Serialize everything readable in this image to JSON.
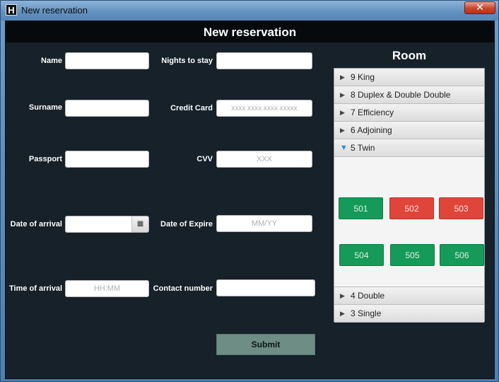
{
  "window": {
    "title": "New reservation",
    "app_icon_letter": "H",
    "close_glyph": "✕"
  },
  "header": {
    "title": "New reservation"
  },
  "form": {
    "name": {
      "label": "Name",
      "value": ""
    },
    "surname": {
      "label": "Surname",
      "value": ""
    },
    "passport": {
      "label": "Passport",
      "value": ""
    },
    "date_of_arrival": {
      "label": "Date of arrival",
      "value": "",
      "calendar_icon": "calendar-icon"
    },
    "time_of_arrival": {
      "label": "Time of arrival",
      "value": "",
      "placeholder": "HH:MM"
    },
    "nights_to_stay": {
      "label": "Nights to stay",
      "value": ""
    },
    "credit_card": {
      "label": "Credit Card",
      "value": "",
      "placeholder": "xxxx xxxx xxxx xxxxx"
    },
    "cvv": {
      "label": "CVV",
      "value": "",
      "placeholder": "XXX"
    },
    "date_of_expire": {
      "label": "Date of Expire",
      "value": "",
      "placeholder": "MM/YY"
    },
    "contact_number": {
      "label": "Contact number",
      "value": ""
    },
    "submit_label": "Submit"
  },
  "room_panel": {
    "title": "Room",
    "groups": [
      {
        "label": "9 King",
        "expanded": false
      },
      {
        "label": "8 Duplex & Double Double",
        "expanded": false
      },
      {
        "label": "7 Efficiency",
        "expanded": false
      },
      {
        "label": "6 Adjoining",
        "expanded": false
      },
      {
        "label": "5 Twin",
        "expanded": true
      },
      {
        "label": "4 Double",
        "expanded": false
      },
      {
        "label": "3 Single",
        "expanded": false
      }
    ],
    "rooms": [
      {
        "number": "501",
        "status": "available"
      },
      {
        "number": "502",
        "status": "occupied"
      },
      {
        "number": "503",
        "status": "occupied"
      },
      {
        "number": "504",
        "status": "available"
      },
      {
        "number": "505",
        "status": "available"
      },
      {
        "number": "506",
        "status": "available"
      }
    ],
    "colors": {
      "available": "#169a5a",
      "occupied": "#e0453a"
    }
  }
}
